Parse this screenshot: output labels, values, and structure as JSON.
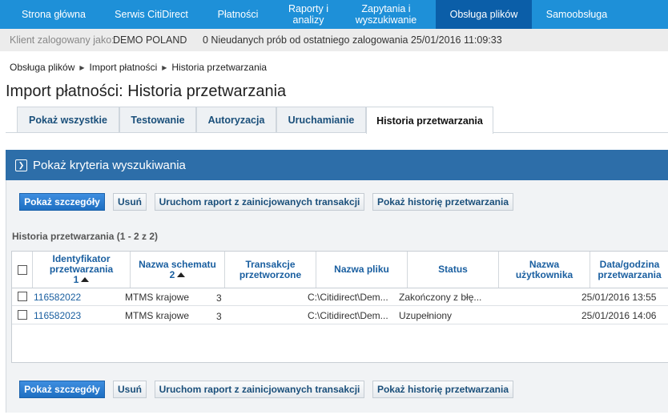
{
  "nav": {
    "items": [
      {
        "label": "Strona główna"
      },
      {
        "label": "Serwis CitiDirect"
      },
      {
        "label": "Płatności"
      },
      {
        "label": "Raporty i\nanalizy"
      },
      {
        "label": "Zapytania i\nwyszukiwanie"
      },
      {
        "label": "Obsługa plików"
      },
      {
        "label": "Samoobsługa"
      }
    ],
    "active_index": 5
  },
  "status": {
    "client_label": "Klient zalogowany jako:",
    "client_name": "DEMO POLAND",
    "login_info": "0 Nieudanych prób od ostatniego zalogowania 25/01/2016 11:09:33"
  },
  "breadcrumb": {
    "items": [
      "Obsługa plików",
      "Import płatności",
      "Historia przetwarzania"
    ]
  },
  "page_title": "Import płatności: Historia przetwarzania",
  "tabs": [
    {
      "label": "Pokaż wszystkie"
    },
    {
      "label": "Testowanie"
    },
    {
      "label": "Autoryzacja"
    },
    {
      "label": "Uruchamianie"
    },
    {
      "label": "Historia przetwarzania",
      "active": true
    }
  ],
  "search_banner": "Pokaż kryteria wyszukiwania",
  "actions": {
    "details": "Pokaż szczegóły",
    "delete": "Usuń",
    "run_report": "Uruchom raport z zainicjowanych transakcji",
    "show_history": "Pokaż historię przetwarzania"
  },
  "history_label": "Historia przetwarzania (1 - 2 z 2)",
  "table": {
    "headers": {
      "id": "Identyfikator przetwarzania",
      "id_sort": "1",
      "schema": "Nazwa schematu",
      "schema_sort": "2",
      "tx": "Transakcje przetworzone",
      "file": "Nazwa pliku",
      "status": "Status",
      "user": "Nazwa użytkownika",
      "date": "Data/godzina przetwarzania"
    },
    "rows": [
      {
        "id": "116582022",
        "schema": "MTMS krajowe",
        "tx": "3",
        "file": "C:\\Citidirect\\Dem...",
        "status": "Zakończony z błę...",
        "user": "",
        "date": "25/01/2016 13:55"
      },
      {
        "id": "116582023",
        "schema": "MTMS krajowe",
        "tx": "3",
        "file": "C:\\Citidirect\\Dem...",
        "status": "Uzupełniony",
        "user": "",
        "date": "25/01/2016 14:06"
      }
    ]
  }
}
